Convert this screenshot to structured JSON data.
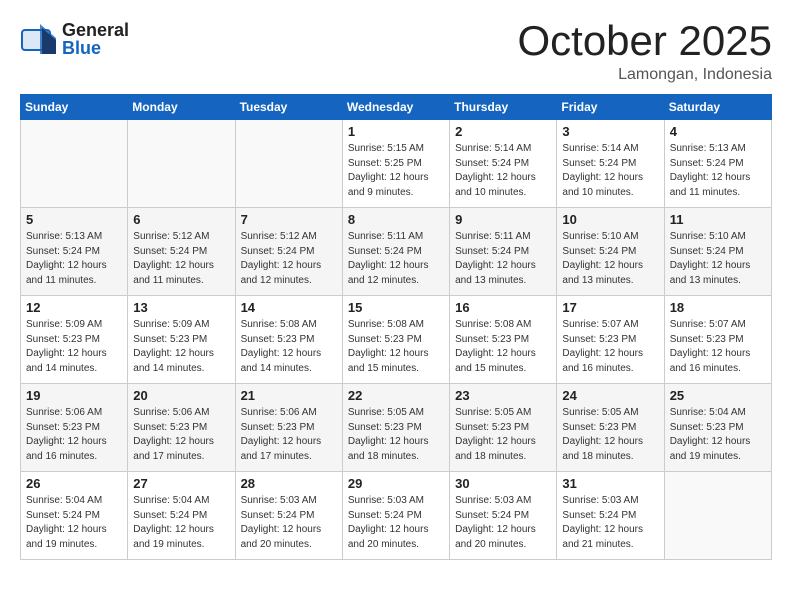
{
  "header": {
    "logo_general": "General",
    "logo_blue": "Blue",
    "month": "October 2025",
    "location": "Lamongan, Indonesia"
  },
  "weekdays": [
    "Sunday",
    "Monday",
    "Tuesday",
    "Wednesday",
    "Thursday",
    "Friday",
    "Saturday"
  ],
  "weeks": [
    [
      {
        "day": "",
        "info": ""
      },
      {
        "day": "",
        "info": ""
      },
      {
        "day": "",
        "info": ""
      },
      {
        "day": "1",
        "info": "Sunrise: 5:15 AM\nSunset: 5:25 PM\nDaylight: 12 hours\nand 9 minutes."
      },
      {
        "day": "2",
        "info": "Sunrise: 5:14 AM\nSunset: 5:24 PM\nDaylight: 12 hours\nand 10 minutes."
      },
      {
        "day": "3",
        "info": "Sunrise: 5:14 AM\nSunset: 5:24 PM\nDaylight: 12 hours\nand 10 minutes."
      },
      {
        "day": "4",
        "info": "Sunrise: 5:13 AM\nSunset: 5:24 PM\nDaylight: 12 hours\nand 11 minutes."
      }
    ],
    [
      {
        "day": "5",
        "info": "Sunrise: 5:13 AM\nSunset: 5:24 PM\nDaylight: 12 hours\nand 11 minutes."
      },
      {
        "day": "6",
        "info": "Sunrise: 5:12 AM\nSunset: 5:24 PM\nDaylight: 12 hours\nand 11 minutes."
      },
      {
        "day": "7",
        "info": "Sunrise: 5:12 AM\nSunset: 5:24 PM\nDaylight: 12 hours\nand 12 minutes."
      },
      {
        "day": "8",
        "info": "Sunrise: 5:11 AM\nSunset: 5:24 PM\nDaylight: 12 hours\nand 12 minutes."
      },
      {
        "day": "9",
        "info": "Sunrise: 5:11 AM\nSunset: 5:24 PM\nDaylight: 12 hours\nand 13 minutes."
      },
      {
        "day": "10",
        "info": "Sunrise: 5:10 AM\nSunset: 5:24 PM\nDaylight: 12 hours\nand 13 minutes."
      },
      {
        "day": "11",
        "info": "Sunrise: 5:10 AM\nSunset: 5:24 PM\nDaylight: 12 hours\nand 13 minutes."
      }
    ],
    [
      {
        "day": "12",
        "info": "Sunrise: 5:09 AM\nSunset: 5:23 PM\nDaylight: 12 hours\nand 14 minutes."
      },
      {
        "day": "13",
        "info": "Sunrise: 5:09 AM\nSunset: 5:23 PM\nDaylight: 12 hours\nand 14 minutes."
      },
      {
        "day": "14",
        "info": "Sunrise: 5:08 AM\nSunset: 5:23 PM\nDaylight: 12 hours\nand 14 minutes."
      },
      {
        "day": "15",
        "info": "Sunrise: 5:08 AM\nSunset: 5:23 PM\nDaylight: 12 hours\nand 15 minutes."
      },
      {
        "day": "16",
        "info": "Sunrise: 5:08 AM\nSunset: 5:23 PM\nDaylight: 12 hours\nand 15 minutes."
      },
      {
        "day": "17",
        "info": "Sunrise: 5:07 AM\nSunset: 5:23 PM\nDaylight: 12 hours\nand 16 minutes."
      },
      {
        "day": "18",
        "info": "Sunrise: 5:07 AM\nSunset: 5:23 PM\nDaylight: 12 hours\nand 16 minutes."
      }
    ],
    [
      {
        "day": "19",
        "info": "Sunrise: 5:06 AM\nSunset: 5:23 PM\nDaylight: 12 hours\nand 16 minutes."
      },
      {
        "day": "20",
        "info": "Sunrise: 5:06 AM\nSunset: 5:23 PM\nDaylight: 12 hours\nand 17 minutes."
      },
      {
        "day": "21",
        "info": "Sunrise: 5:06 AM\nSunset: 5:23 PM\nDaylight: 12 hours\nand 17 minutes."
      },
      {
        "day": "22",
        "info": "Sunrise: 5:05 AM\nSunset: 5:23 PM\nDaylight: 12 hours\nand 18 minutes."
      },
      {
        "day": "23",
        "info": "Sunrise: 5:05 AM\nSunset: 5:23 PM\nDaylight: 12 hours\nand 18 minutes."
      },
      {
        "day": "24",
        "info": "Sunrise: 5:05 AM\nSunset: 5:23 PM\nDaylight: 12 hours\nand 18 minutes."
      },
      {
        "day": "25",
        "info": "Sunrise: 5:04 AM\nSunset: 5:23 PM\nDaylight: 12 hours\nand 19 minutes."
      }
    ],
    [
      {
        "day": "26",
        "info": "Sunrise: 5:04 AM\nSunset: 5:24 PM\nDaylight: 12 hours\nand 19 minutes."
      },
      {
        "day": "27",
        "info": "Sunrise: 5:04 AM\nSunset: 5:24 PM\nDaylight: 12 hours\nand 19 minutes."
      },
      {
        "day": "28",
        "info": "Sunrise: 5:03 AM\nSunset: 5:24 PM\nDaylight: 12 hours\nand 20 minutes."
      },
      {
        "day": "29",
        "info": "Sunrise: 5:03 AM\nSunset: 5:24 PM\nDaylight: 12 hours\nand 20 minutes."
      },
      {
        "day": "30",
        "info": "Sunrise: 5:03 AM\nSunset: 5:24 PM\nDaylight: 12 hours\nand 20 minutes."
      },
      {
        "day": "31",
        "info": "Sunrise: 5:03 AM\nSunset: 5:24 PM\nDaylight: 12 hours\nand 21 minutes."
      },
      {
        "day": "",
        "info": ""
      }
    ]
  ]
}
